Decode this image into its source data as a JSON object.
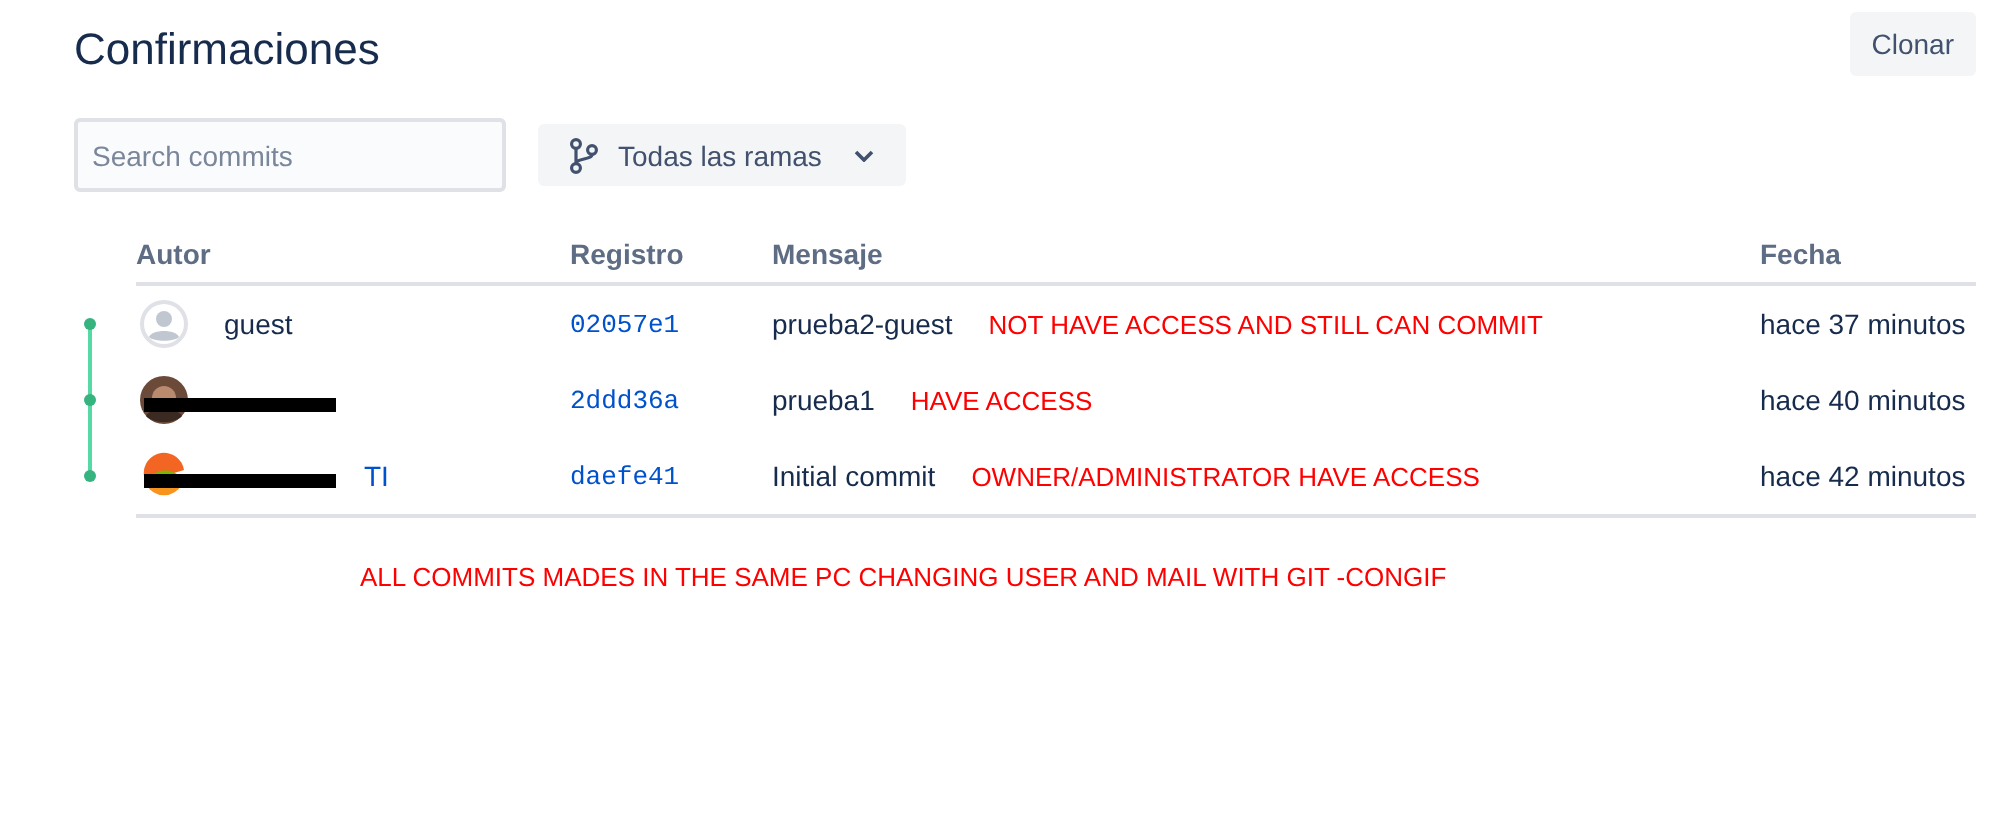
{
  "page": {
    "title": "Confirmaciones",
    "clone_button": "Clonar"
  },
  "search": {
    "placeholder": "Search commits"
  },
  "branch_filter": {
    "label": "Todas las ramas"
  },
  "table": {
    "columns": [
      "Autor",
      "Registro",
      "Mensaje",
      "Fecha"
    ],
    "rows": [
      {
        "kind": "default",
        "author": "guest",
        "redacted": false,
        "hash": "02057e1",
        "message": "prueba2-guest",
        "annotation": "NOT HAVE ACCESS AND STILL CAN COMMIT",
        "date": "hace 37 minutos"
      },
      {
        "kind": "photo",
        "redacted": true,
        "hash": "2ddd36a",
        "message": "prueba1",
        "annotation": "HAVE ACCESS",
        "date": "hace 40 minutos"
      },
      {
        "kind": "logo",
        "author": "TI",
        "redacted": true,
        "hash": "daefe41",
        "message": "Initial commit",
        "annotation": "OWNER/ADMINISTRATOR HAVE ACCESS",
        "date": "hace 42 minutos"
      }
    ]
  },
  "note": "ALL COMMITS MADES IN THE SAME PC CHANGING USER AND MAIL WITH GIT -CONGIF"
}
